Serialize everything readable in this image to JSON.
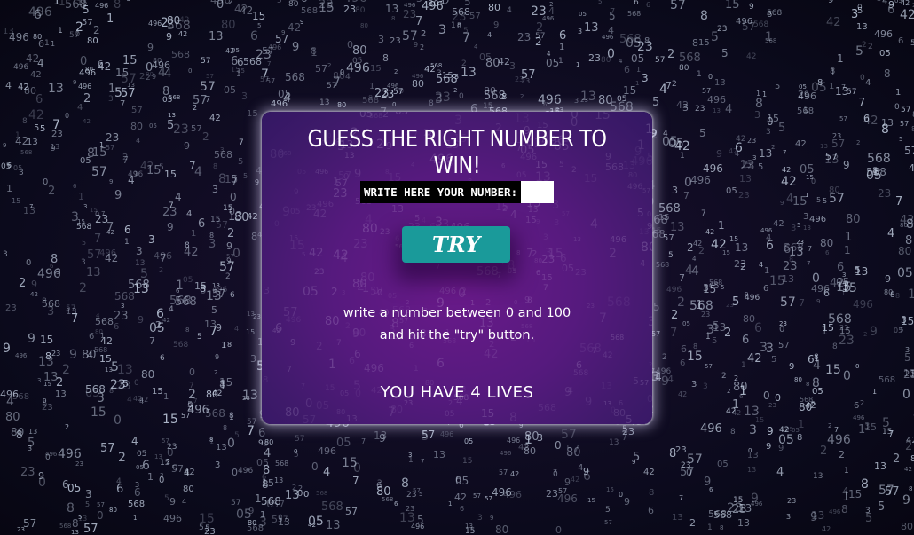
{
  "game": {
    "title": "GUESS THE RIGHT NUMBER TO WIN!",
    "input_label": "WRITE HERE YOUR NUMBER:",
    "input_value": "",
    "try_label": "TRY",
    "instructions_line1": "write a number between 0 and 100",
    "instructions_line2": "and hit the \"try\" button.",
    "lives_text": "YOU HAVE 4 LIVES"
  },
  "colors": {
    "card_purple": "#561a7e",
    "button_teal": "#1a9a9a",
    "background": "#0a0818"
  },
  "background_digits": [
    "0",
    "1",
    "2",
    "3",
    "4",
    "5",
    "6",
    "7",
    "8",
    "9",
    "23",
    "42",
    "57",
    "568",
    "496",
    "15",
    "80",
    "13",
    "05"
  ]
}
